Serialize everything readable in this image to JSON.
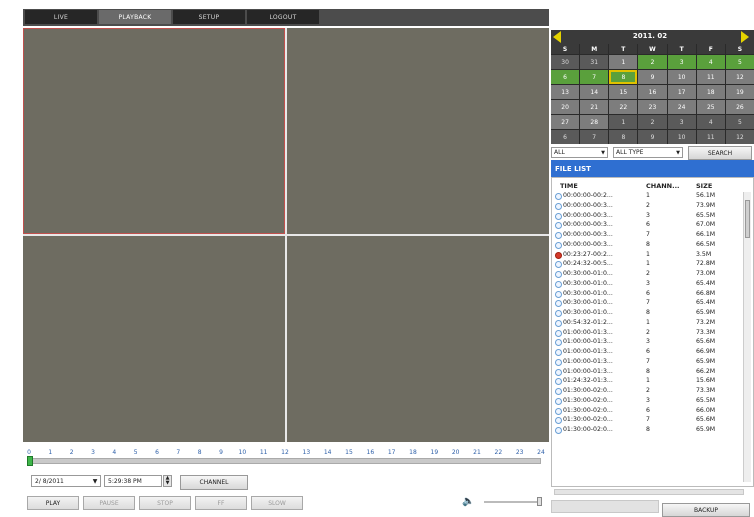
{
  "nav": {
    "tabs": [
      "LIVE",
      "PLAYBACK",
      "SETUP",
      "LOGOUT"
    ],
    "active": "PLAYBACK"
  },
  "timeline": {
    "hours": [
      "0",
      "1",
      "2",
      "3",
      "4",
      "5",
      "6",
      "7",
      "8",
      "9",
      "10",
      "11",
      "12",
      "13",
      "14",
      "15",
      "16",
      "17",
      "18",
      "19",
      "20",
      "21",
      "22",
      "23",
      "24"
    ],
    "position_hour": 0
  },
  "controls": {
    "date": "2/ 8/2011",
    "time": "5:29:38 PM",
    "channel_label": "CHANNEL",
    "buttons": [
      "PLAY",
      "PAUSE",
      "STOP",
      "FF",
      "SLOW"
    ]
  },
  "calendar": {
    "title": "2011. 02",
    "weekdays": [
      "S",
      "M",
      "T",
      "W",
      "T",
      "F",
      "S"
    ],
    "days": [
      {
        "d": "30",
        "s": "dim"
      },
      {
        "d": "31",
        "s": "dim"
      },
      {
        "d": "1",
        "s": "norm"
      },
      {
        "d": "2",
        "s": "rec"
      },
      {
        "d": "3",
        "s": "rec"
      },
      {
        "d": "4",
        "s": "rec"
      },
      {
        "d": "5",
        "s": "rec"
      },
      {
        "d": "6",
        "s": "rec"
      },
      {
        "d": "7",
        "s": "rec"
      },
      {
        "d": "8",
        "s": "cur"
      },
      {
        "d": "9",
        "s": "norm"
      },
      {
        "d": "10",
        "s": "norm"
      },
      {
        "d": "11",
        "s": "norm"
      },
      {
        "d": "12",
        "s": "norm"
      },
      {
        "d": "13",
        "s": "norm"
      },
      {
        "d": "14",
        "s": "norm"
      },
      {
        "d": "15",
        "s": "norm"
      },
      {
        "d": "16",
        "s": "norm"
      },
      {
        "d": "17",
        "s": "norm"
      },
      {
        "d": "18",
        "s": "norm"
      },
      {
        "d": "19",
        "s": "norm"
      },
      {
        "d": "20",
        "s": "norm"
      },
      {
        "d": "21",
        "s": "norm"
      },
      {
        "d": "22",
        "s": "norm"
      },
      {
        "d": "23",
        "s": "norm"
      },
      {
        "d": "24",
        "s": "norm"
      },
      {
        "d": "25",
        "s": "norm"
      },
      {
        "d": "26",
        "s": "norm"
      },
      {
        "d": "27",
        "s": "norm"
      },
      {
        "d": "28",
        "s": "norm"
      },
      {
        "d": "1",
        "s": "dim"
      },
      {
        "d": "2",
        "s": "dim"
      },
      {
        "d": "3",
        "s": "dim"
      },
      {
        "d": "4",
        "s": "dim"
      },
      {
        "d": "5",
        "s": "dim"
      },
      {
        "d": "6",
        "s": "dim"
      },
      {
        "d": "7",
        "s": "dim"
      },
      {
        "d": "8",
        "s": "dim"
      },
      {
        "d": "9",
        "s": "dim"
      },
      {
        "d": "10",
        "s": "dim"
      },
      {
        "d": "11",
        "s": "dim"
      },
      {
        "d": "12",
        "s": "dim"
      }
    ],
    "colors": {
      "record": "#5aa03c",
      "selected_border": "#e0c200",
      "normal": "#7d7d7d"
    }
  },
  "filters": {
    "channel": "ALL",
    "type": "ALL TYPE",
    "search_label": "SEARCH"
  },
  "file_list": {
    "title": "FILE LIST",
    "columns": [
      "TIME",
      "CHANN...",
      "SIZE"
    ],
    "rows": [
      {
        "time": "00:00:00-00:2...",
        "ch": "1",
        "size": "56.1M",
        "icon": "file"
      },
      {
        "time": "00:00:00-00:3...",
        "ch": "2",
        "size": "73.9M",
        "icon": "file"
      },
      {
        "time": "00:00:00-00:3...",
        "ch": "3",
        "size": "65.5M",
        "icon": "file"
      },
      {
        "time": "00:00:00-00:3...",
        "ch": "6",
        "size": "67.0M",
        "icon": "file"
      },
      {
        "time": "00:00:00-00:3...",
        "ch": "7",
        "size": "66.1M",
        "icon": "file"
      },
      {
        "time": "00:00:00-00:3...",
        "ch": "8",
        "size": "66.5M",
        "icon": "file"
      },
      {
        "time": "00:23:27-00:2...",
        "ch": "1",
        "size": "3.5M",
        "icon": "alert"
      },
      {
        "time": "00:24:32-00:5...",
        "ch": "1",
        "size": "72.8M",
        "icon": "file"
      },
      {
        "time": "00:30:00-01:0...",
        "ch": "2",
        "size": "73.0M",
        "icon": "file"
      },
      {
        "time": "00:30:00-01:0...",
        "ch": "3",
        "size": "65.4M",
        "icon": "file"
      },
      {
        "time": "00:30:00-01:0...",
        "ch": "6",
        "size": "66.8M",
        "icon": "file"
      },
      {
        "time": "00:30:00-01:0...",
        "ch": "7",
        "size": "65.4M",
        "icon": "file"
      },
      {
        "time": "00:30:00-01:0...",
        "ch": "8",
        "size": "65.9M",
        "icon": "file"
      },
      {
        "time": "00:54:32-01:2...",
        "ch": "1",
        "size": "73.2M",
        "icon": "file"
      },
      {
        "time": "01:00:00-01:3...",
        "ch": "2",
        "size": "73.3M",
        "icon": "file"
      },
      {
        "time": "01:00:00-01:3...",
        "ch": "3",
        "size": "65.6M",
        "icon": "file"
      },
      {
        "time": "01:00:00-01:3...",
        "ch": "6",
        "size": "66.9M",
        "icon": "file"
      },
      {
        "time": "01:00:00-01:3...",
        "ch": "7",
        "size": "65.9M",
        "icon": "file"
      },
      {
        "time": "01:00:00-01:3...",
        "ch": "8",
        "size": "66.2M",
        "icon": "file"
      },
      {
        "time": "01:24:32-01:3...",
        "ch": "1",
        "size": "15.6M",
        "icon": "file"
      },
      {
        "time": "01:30:00-02:0...",
        "ch": "2",
        "size": "73.3M",
        "icon": "file"
      },
      {
        "time": "01:30:00-02:0...",
        "ch": "3",
        "size": "65.5M",
        "icon": "file"
      },
      {
        "time": "01:30:00-02:0...",
        "ch": "6",
        "size": "66.0M",
        "icon": "file"
      },
      {
        "time": "01:30:00-02:0...",
        "ch": "7",
        "size": "65.6M",
        "icon": "file"
      },
      {
        "time": "01:30:00-02:0...",
        "ch": "8",
        "size": "65.9M",
        "icon": "file"
      }
    ]
  },
  "backup_label": "BACKUP"
}
